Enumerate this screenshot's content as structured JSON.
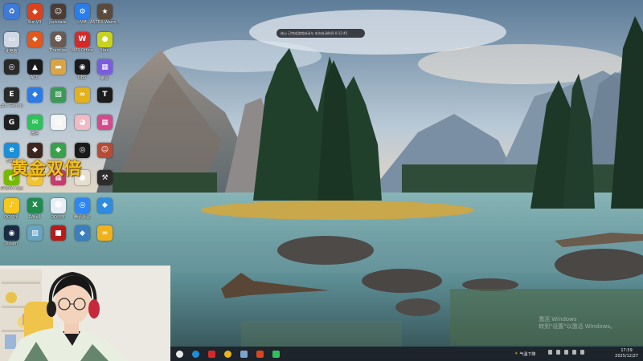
{
  "desktop": {
    "promo_text": "黄金双倍",
    "icons": [
      {
        "label": "",
        "icon": "recycle-bin-icon",
        "color": "#3f7ad6",
        "glyph": "♻"
      },
      {
        "label": "Sur V3",
        "icon": "app-red-icon",
        "color": "#d8431f",
        "glyph": "◆"
      },
      {
        "label": "Jackdate",
        "icon": "game-avatar-icon",
        "color": "#4b3c36",
        "glyph": "☺"
      },
      {
        "label": "UVM",
        "icon": "blue-gear-icon",
        "color": "#2b7de9",
        "glyph": "⚙"
      },
      {
        "label": "ASTRX Warm Solutions",
        "icon": "game-poster-icon",
        "color": "#5a4a3e",
        "glyph": "★"
      },
      {
        "label": "此电脑",
        "icon": "computer-icon",
        "color": "#cfd8e4",
        "glyph": "▭"
      },
      {
        "label": "",
        "icon": "red-app-icon",
        "color": "#e2571d",
        "glyph": "◆"
      },
      {
        "label": "Thamiga",
        "icon": "game-character-icon",
        "color": "#6a5b52",
        "glyph": "☻"
      },
      {
        "label": "WPS Office",
        "icon": "wps-icon",
        "color": "#d42a2a",
        "glyph": "W"
      },
      {
        "label": "Stan",
        "icon": "yellow-blob-icon",
        "color": "#c9d21f",
        "glyph": "●"
      },
      {
        "label": "",
        "icon": "dark-circle-icon",
        "color": "#2a2a2a",
        "glyph": "◎"
      },
      {
        "label": "ACC",
        "icon": "green-triangle-icon",
        "color": "#1a1a1a",
        "glyph": "▲"
      },
      {
        "label": "",
        "icon": "folder-icon",
        "color": "#d9a441",
        "glyph": "▬"
      },
      {
        "label": "OBS",
        "icon": "obs-icon",
        "color": "#1b1b1b",
        "glyph": "◉"
      },
      {
        "label": "聚合",
        "icon": "pink-app-icon",
        "color": "#7b5be0",
        "glyph": "▦"
      },
      {
        "label": "Epic Games",
        "icon": "epic-games-icon",
        "color": "#2a2a2a",
        "glyph": "E"
      },
      {
        "label": "",
        "icon": "blue-box-icon",
        "color": "#2c7be5",
        "glyph": "◆"
      },
      {
        "label": "",
        "icon": "map-icon",
        "color": "#3d9a56",
        "glyph": "▧"
      },
      {
        "label": "",
        "icon": "glasses-icon",
        "color": "#e3b11a",
        "glyph": "∞"
      },
      {
        "label": "",
        "icon": "red-t-icon",
        "color": "#1b1b1b",
        "glyph": "T"
      },
      {
        "label": "",
        "icon": "g-logo-icon",
        "color": "#1f1f1f",
        "glyph": "G"
      },
      {
        "label": "微信",
        "icon": "wechat-icon",
        "color": "#2fc15a",
        "glyph": "✉"
      },
      {
        "label": "",
        "icon": "document-icon",
        "color": "#f4f4f4",
        "glyph": "▤"
      },
      {
        "label": "",
        "icon": "pig-icon",
        "color": "#f0b9c3",
        "glyph": "◕"
      },
      {
        "label": "",
        "icon": "cubes-icon",
        "color": "#d34b8a",
        "glyph": "▦"
      },
      {
        "label": "Edge",
        "icon": "edge-icon",
        "color": "#1d8fd6",
        "glyph": "e"
      },
      {
        "label": "",
        "icon": "game-dark-icon",
        "color": "#3d2620",
        "glyph": "◆"
      },
      {
        "label": "",
        "icon": "game-green-icon",
        "color": "#38a24b",
        "glyph": "◆"
      },
      {
        "label": "",
        "icon": "obs-ring-icon",
        "color": "#1a1a1a",
        "glyph": "◎"
      },
      {
        "label": "",
        "icon": "game-face-icon",
        "color": "#b64b36",
        "glyph": "☺"
      },
      {
        "label": "NVIDIA App",
        "icon": "nvidia-icon",
        "color": "#76b900",
        "glyph": "◐"
      },
      {
        "label": "",
        "icon": "yellow-face-icon",
        "color": "#f2c430",
        "glyph": "☺"
      },
      {
        "label": "",
        "icon": "game-grid-icon",
        "color": "#c43d6b",
        "glyph": "▦"
      },
      {
        "label": "",
        "icon": "egg-icon",
        "color": "#e6dfcf",
        "glyph": "●"
      },
      {
        "label": "",
        "icon": "tool-icon",
        "color": "#2d2d2d",
        "glyph": "⚒"
      },
      {
        "label": "QQ音乐",
        "icon": "qq-music-icon",
        "color": "#f6c81d",
        "glyph": "♪"
      },
      {
        "label": "【Win】",
        "icon": "excel-icon",
        "color": "#1f8a4c",
        "glyph": "X"
      },
      {
        "label": "QQ浏览",
        "icon": "qq-browser-icon",
        "color": "#e8eef6",
        "glyph": "☻"
      },
      {
        "label": "腾讯会议",
        "icon": "meeting-icon",
        "color": "#2d86f5",
        "glyph": "◎"
      },
      {
        "label": "",
        "icon": "blue-game-icon",
        "color": "#2f8be0",
        "glyph": "◆"
      },
      {
        "label": "Steam",
        "icon": "steam-icon",
        "color": "#1a2b44",
        "glyph": "◉"
      },
      {
        "label": "",
        "icon": "game-scene-icon",
        "color": "#6aa3c2",
        "glyph": "▧"
      },
      {
        "label": "",
        "icon": "game-red-icon",
        "color": "#b81b1b",
        "glyph": "■"
      },
      {
        "label": "",
        "icon": "game-blue-icon",
        "color": "#3c7fc0",
        "glyph": "◆"
      },
      {
        "label": "",
        "icon": "sunglasses-icon",
        "color": "#f0b21c",
        "glyph": "∞"
      }
    ]
  },
  "toast": {
    "text": "核心 已完成游戏启动与 本次启动时间 0:12:45"
  },
  "taskbar": {
    "items": [
      {
        "icon": "start-icon",
        "color": "#e8e8e8"
      },
      {
        "icon": "edge-taskbar-icon",
        "color": "#1d8fd6"
      },
      {
        "icon": "wps-taskbar-icon",
        "color": "#d42a2a"
      },
      {
        "icon": "chrome-icon",
        "color": "#e8b521"
      },
      {
        "icon": "steam-taskbar-icon",
        "color": "#7aa5cc"
      },
      {
        "icon": "red-app-taskbar-icon",
        "color": "#d9451c"
      },
      {
        "icon": "wechat-taskbar-icon",
        "color": "#2fc15a"
      }
    ],
    "weather": "气温下降",
    "clock_time": "17:59",
    "clock_date": "2025/12/27"
  },
  "activation": {
    "line1": "激活 Windows",
    "line2": "转到\"设置\"以激活 Windows。"
  }
}
